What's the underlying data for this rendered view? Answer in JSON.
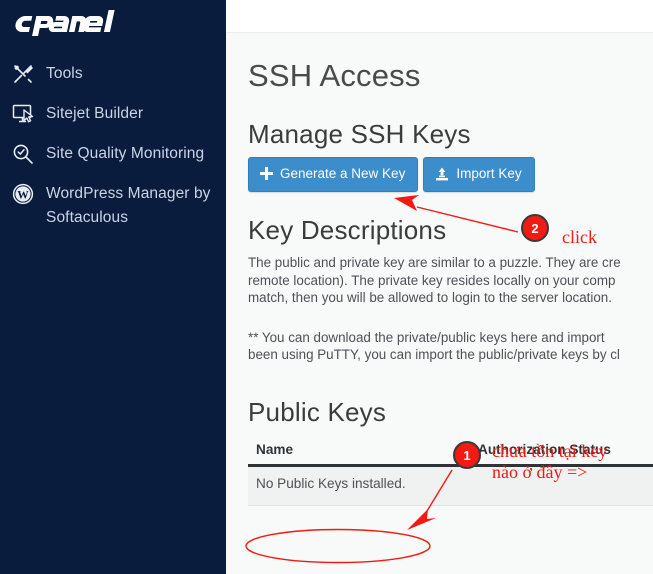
{
  "sidebar": {
    "brand": "cPanel",
    "items": [
      {
        "label": "Tools",
        "icon": "tools-icon"
      },
      {
        "label": "Sitejet Builder",
        "icon": "monitor-cursor-icon"
      },
      {
        "label": "Site Quality Monitoring",
        "icon": "magnifier-check-icon"
      },
      {
        "label": "WordPress Manager by Softaculous",
        "icon": "wordpress-icon"
      }
    ]
  },
  "main": {
    "page_title": "SSH Access",
    "manage_section": {
      "title": "Manage SSH Keys",
      "generate_button": "Generate a New Key",
      "import_button": "Import Key"
    },
    "key_descriptions": {
      "title": "Key Descriptions",
      "paragraph_1_line_1": "The public and private key are similar to a puzzle. They are cre",
      "paragraph_1_line_2": "remote location). The private key resides locally on your comp",
      "paragraph_1_line_3": "match, then you will be allowed to login to the server location.",
      "paragraph_2_line_1": "** You can download the private/public keys here and import",
      "paragraph_2_line_2": "been using PuTTY, you can import the public/private keys by cl"
    },
    "public_keys": {
      "title": "Public Keys",
      "columns": [
        "Name",
        "Authorization Status"
      ],
      "empty_message": "No Public Keys installed."
    }
  },
  "annotations": {
    "badge_1": "1",
    "badge_2": "2",
    "click_label": "click",
    "vietnamese_line_1": "chưa tồn tại key",
    "vietnamese_line_2": "nào ở đây =>"
  },
  "colors": {
    "sidebar_bg": "#0a1c3d",
    "content_bg": "#f8f9f9",
    "button_blue": "#3c8dcc",
    "annotation_red": "#f21a12"
  }
}
